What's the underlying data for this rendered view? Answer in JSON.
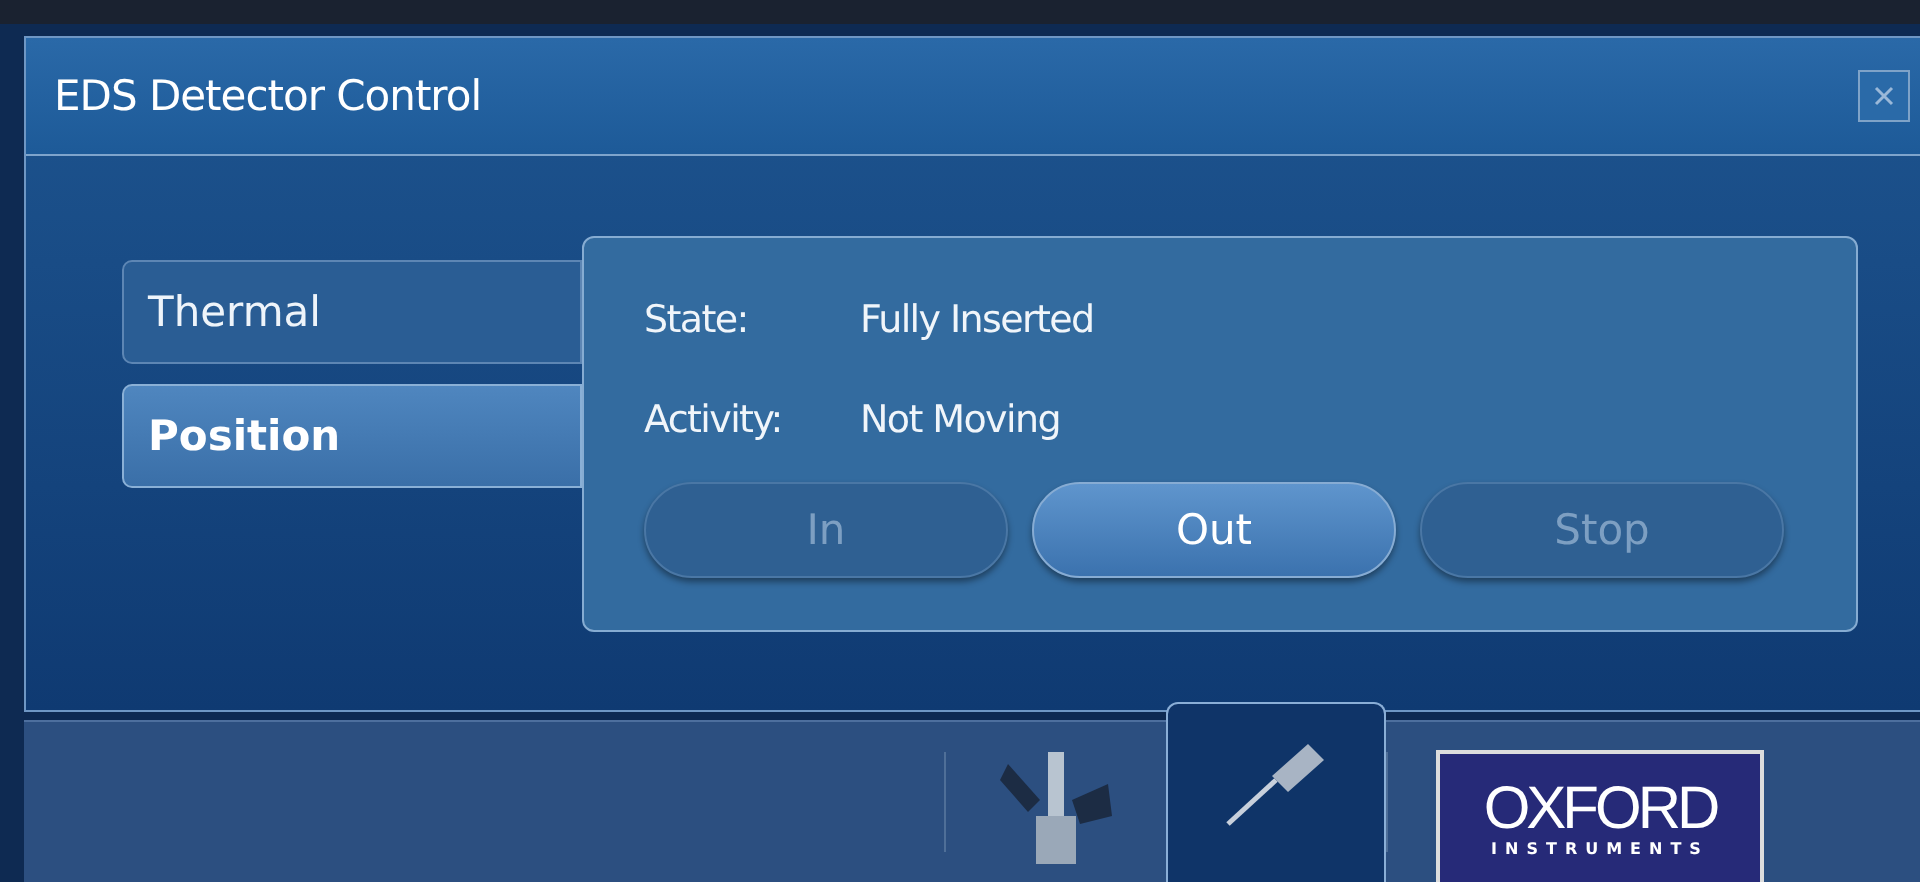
{
  "window": {
    "title": "EDS Detector Control"
  },
  "tabs": [
    {
      "label": "Thermal",
      "selected": false
    },
    {
      "label": "Position",
      "selected": true
    }
  ],
  "status": [
    {
      "label": "State:",
      "value": "Fully Inserted"
    },
    {
      "label": "Activity:",
      "value": "Not Moving"
    }
  ],
  "buttons": [
    {
      "label": "In",
      "disabled": true
    },
    {
      "label": "Out",
      "disabled": false
    },
    {
      "label": "Stop",
      "disabled": true
    }
  ],
  "taskbar": [
    {
      "kind": "stage",
      "selected": false
    },
    {
      "kind": "detector",
      "selected": true
    }
  ],
  "logo": {
    "name": "OXFORD",
    "sub": "INSTRUMENTS"
  }
}
